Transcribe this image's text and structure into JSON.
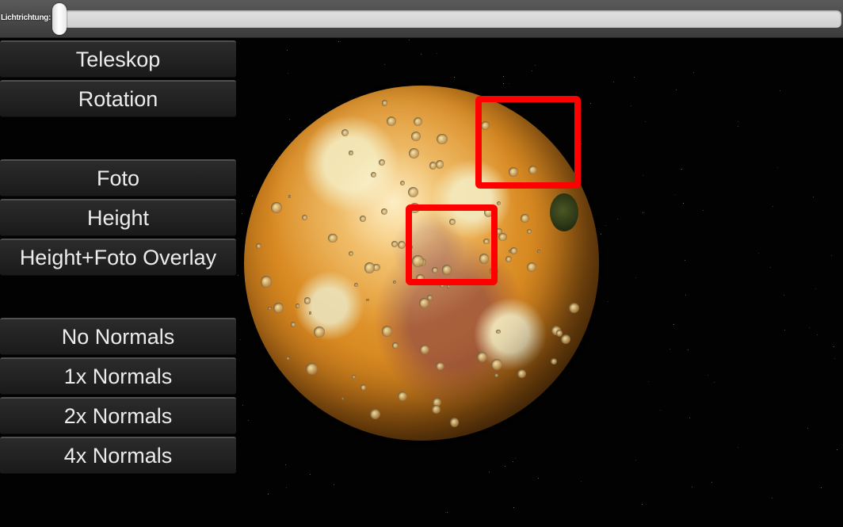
{
  "slider": {
    "label": "Lichtrichtung:",
    "value": 0.0
  },
  "buttons": {
    "view_mode": [
      "Teleskop",
      "Rotation"
    ],
    "texture": [
      "Foto",
      "Height",
      "Height+Foto Overlay"
    ],
    "normals": [
      "No Normals",
      "1x Normals",
      "2x Normals",
      "4x Normals"
    ]
  },
  "colors": {
    "highlight": "#ff0000",
    "background": "#020203",
    "button_text": "#ececec"
  }
}
